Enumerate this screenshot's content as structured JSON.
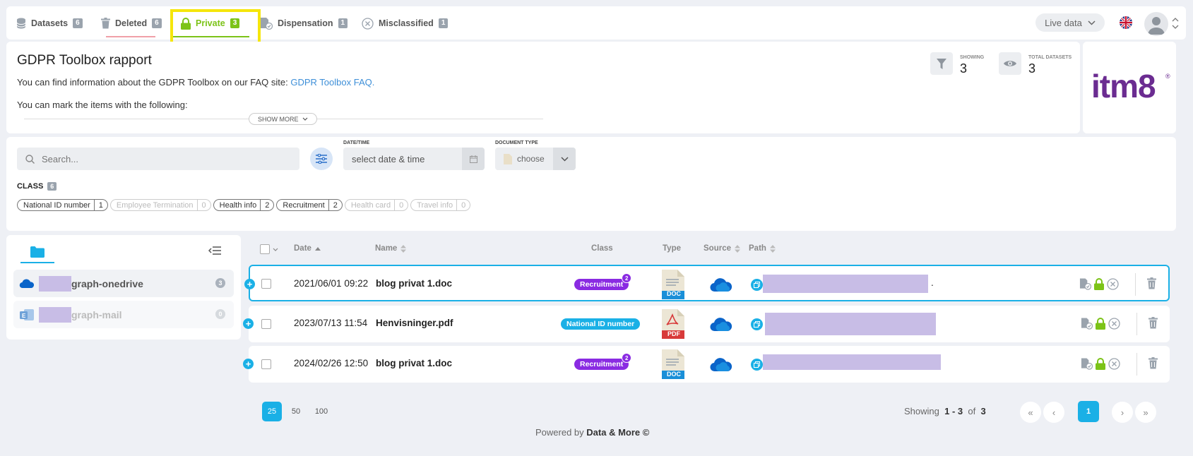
{
  "nav": {
    "tabs": [
      {
        "label": "Datasets",
        "count": "6"
      },
      {
        "label": "Deleted",
        "count": "6"
      },
      {
        "label": "Private",
        "count": "3"
      },
      {
        "label": "Dispensation",
        "count": "1"
      },
      {
        "label": "Misclassified",
        "count": "1"
      }
    ],
    "live_data": "Live data",
    "accent_color": "#7cc318"
  },
  "info": {
    "title": "GDPR Toolbox rapport",
    "line1_prefix": "You can find information about the",
    "line1_mid": "GDPR Toolbox on our FAQ site:",
    "faq_link": "GDPR Toolbox FAQ.",
    "line2": "You can mark the items with the following:",
    "show_more": "SHOW MORE",
    "showing_label": "SHOWING",
    "showing_value": "3",
    "total_label": "TOTAL DATASETS",
    "total_value": "3",
    "logo": "itm8",
    "logo_mark": "®"
  },
  "filter": {
    "search_placeholder": "Search...",
    "date_label": "DATE/TIME",
    "date_placeholder": "select date & time",
    "doctype_label": "DOCUMENT TYPE",
    "doctype_value": "choose",
    "class_label": "CLASS",
    "class_count": "6",
    "chips": [
      {
        "label": "National ID number",
        "count": "1"
      },
      {
        "label": "Employee Termination",
        "count": "0"
      },
      {
        "label": "Health info",
        "count": "2"
      },
      {
        "label": "Recruitment",
        "count": "2"
      },
      {
        "label": "Health card",
        "count": "0"
      },
      {
        "label": "Travel info",
        "count": "0"
      }
    ]
  },
  "sidebar": {
    "items": [
      {
        "label": "graph-onedrive",
        "count": "3"
      },
      {
        "label": "graph-mail",
        "count": "0"
      }
    ]
  },
  "table": {
    "headers": {
      "date": "Date",
      "name": "Name",
      "class": "Class",
      "type": "Type",
      "source": "Source",
      "path": "Path"
    },
    "rows": [
      {
        "date": "2021/06/01 09:22",
        "name": "blog privat 1.doc",
        "class": "Recruitment",
        "class_count": "2",
        "type": "DOC",
        "path_suffix": "."
      },
      {
        "date": "2023/07/13 11:54",
        "name": "Henvisninger.pdf",
        "class": "National ID number",
        "class_count": "",
        "type": "PDF",
        "path_suffix": ""
      },
      {
        "date": "2024/02/26 12:50",
        "name": "blog privat 1.doc",
        "class": "Recruitment",
        "class_count": "2",
        "type": "DOC",
        "path_suffix": ""
      }
    ]
  },
  "pagination": {
    "sizes": [
      "25",
      "50",
      "100"
    ],
    "showing_prefix": "Showing",
    "range": "1 - 3",
    "of": "of",
    "total": "3",
    "page": "1",
    "first": "«",
    "prev": "‹",
    "next": "›",
    "last": "»"
  },
  "footer": {
    "prefix": "Powered by",
    "brand": "Data & More ©"
  }
}
